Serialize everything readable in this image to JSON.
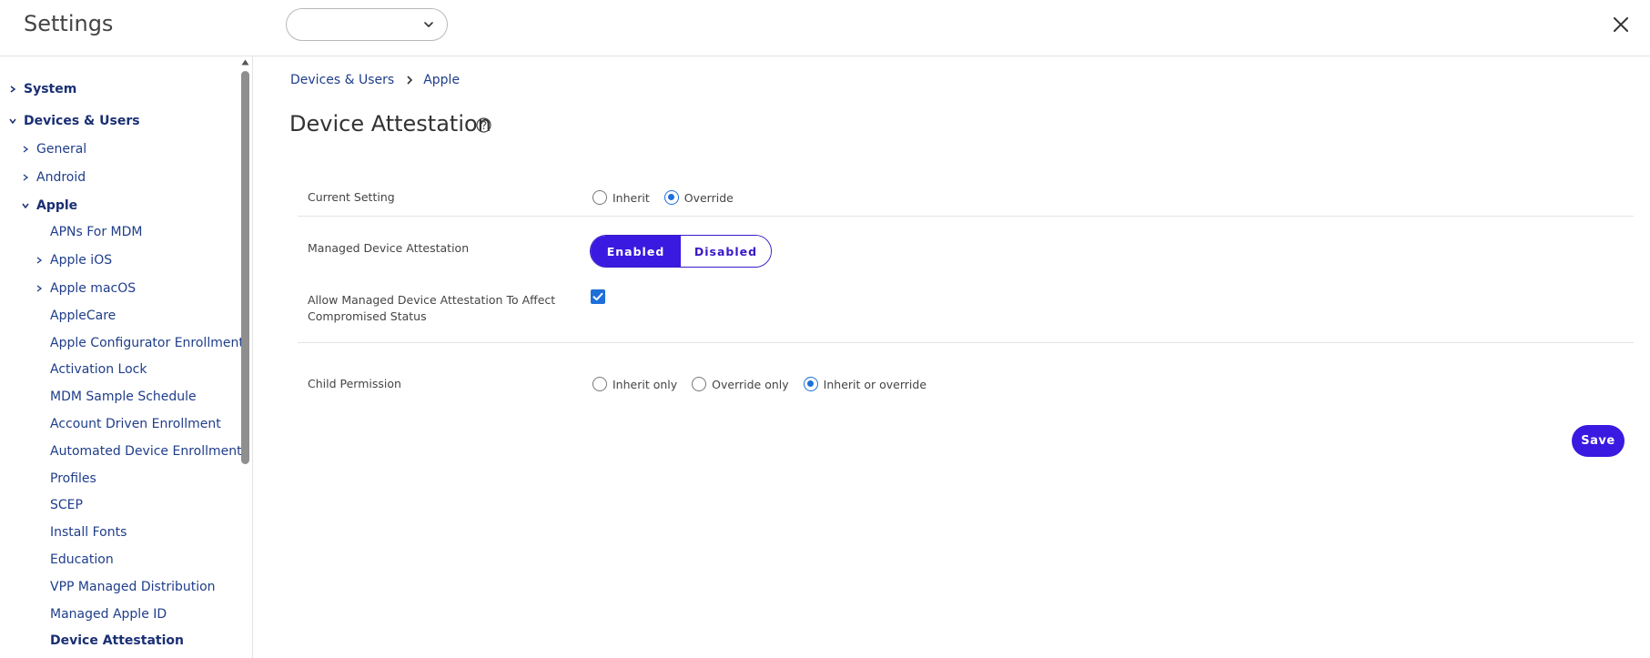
{
  "app": {
    "title": "Settings"
  },
  "header": {
    "org_select_value": ""
  },
  "sidebar": {
    "items": [
      {
        "label": "System"
      },
      {
        "label": "Devices & Users"
      },
      {
        "label": "General"
      },
      {
        "label": "Android"
      },
      {
        "label": "Apple"
      },
      {
        "label": "APNs For MDM"
      },
      {
        "label": "Apple iOS"
      },
      {
        "label": "Apple macOS"
      },
      {
        "label": "AppleCare"
      },
      {
        "label": "Apple Configurator Enrollment"
      },
      {
        "label": "Activation Lock"
      },
      {
        "label": "MDM Sample Schedule"
      },
      {
        "label": "Account Driven Enrollment"
      },
      {
        "label": "Automated Device Enrollment"
      },
      {
        "label": "Profiles"
      },
      {
        "label": "SCEP"
      },
      {
        "label": "Install Fonts"
      },
      {
        "label": "Education"
      },
      {
        "label": "VPP Managed Distribution"
      },
      {
        "label": "Managed Apple ID"
      },
      {
        "label": "Device Attestation"
      }
    ]
  },
  "breadcrumb": {
    "items": [
      "Devices & Users",
      "Apple"
    ]
  },
  "page": {
    "title": "Device Attestation"
  },
  "settings": {
    "current_setting": {
      "label": "Current Setting",
      "options": [
        "Inherit",
        "Override"
      ],
      "selected": "Override"
    },
    "managed_device_attestation": {
      "label": "Managed Device Attestation",
      "enabled_label": "Enabled",
      "disabled_label": "Disabled",
      "value": "Enabled"
    },
    "affect_compromised": {
      "label_line1": "Allow Managed Device Attestation To Affect",
      "label_line2": "Compromised Status",
      "checked": true
    },
    "child_permission": {
      "label": "Child Permission",
      "options": [
        "Inherit only",
        "Override only",
        "Inherit or override"
      ],
      "selected": "Inherit or override"
    }
  },
  "actions": {
    "save_label": "Save"
  },
  "colors": {
    "accent": "#3a19e0",
    "link": "#1f3d8a",
    "checked": "#1e6fd9"
  }
}
